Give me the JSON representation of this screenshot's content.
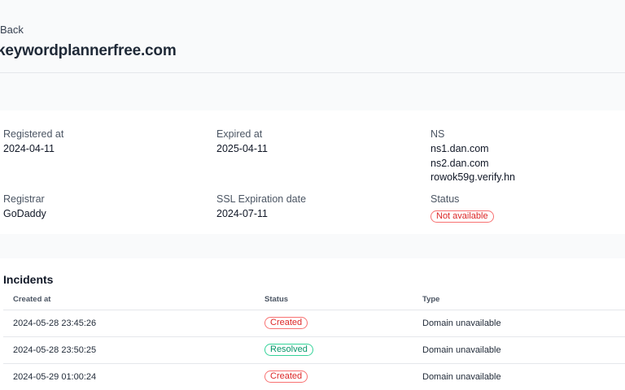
{
  "header": {
    "back_label": "Back",
    "domain": "keywordplannerfree.com"
  },
  "details": {
    "registered_at": {
      "label": "Registered at",
      "value": "2024-04-11"
    },
    "expired_at": {
      "label": "Expired at",
      "value": "2025-04-11"
    },
    "ns": {
      "label": "NS",
      "values": [
        "ns1.dan.com",
        "ns2.dan.com",
        "rowok59g.verify.hn"
      ]
    },
    "registrar": {
      "label": "Registrar",
      "value": "GoDaddy"
    },
    "ssl_expiration": {
      "label": "SSL Expiration date",
      "value": "2024-07-11"
    },
    "status": {
      "label": "Status",
      "value": "Not available",
      "color": "#dc2626"
    }
  },
  "incidents": {
    "title": "Incidents",
    "columns": [
      "Created at",
      "Status",
      "Type"
    ],
    "rows": [
      {
        "created_at": "2024-05-28 23:45:26",
        "status": "Created",
        "type": "Domain unavailable"
      },
      {
        "created_at": "2024-05-28 23:50:25",
        "status": "Resolved",
        "type": "Domain unavailable"
      },
      {
        "created_at": "2024-05-29 01:00:24",
        "status": "Created",
        "type": "Domain unavailable"
      }
    ]
  },
  "colors": {
    "created": "#dc2626",
    "resolved": "#059669"
  }
}
